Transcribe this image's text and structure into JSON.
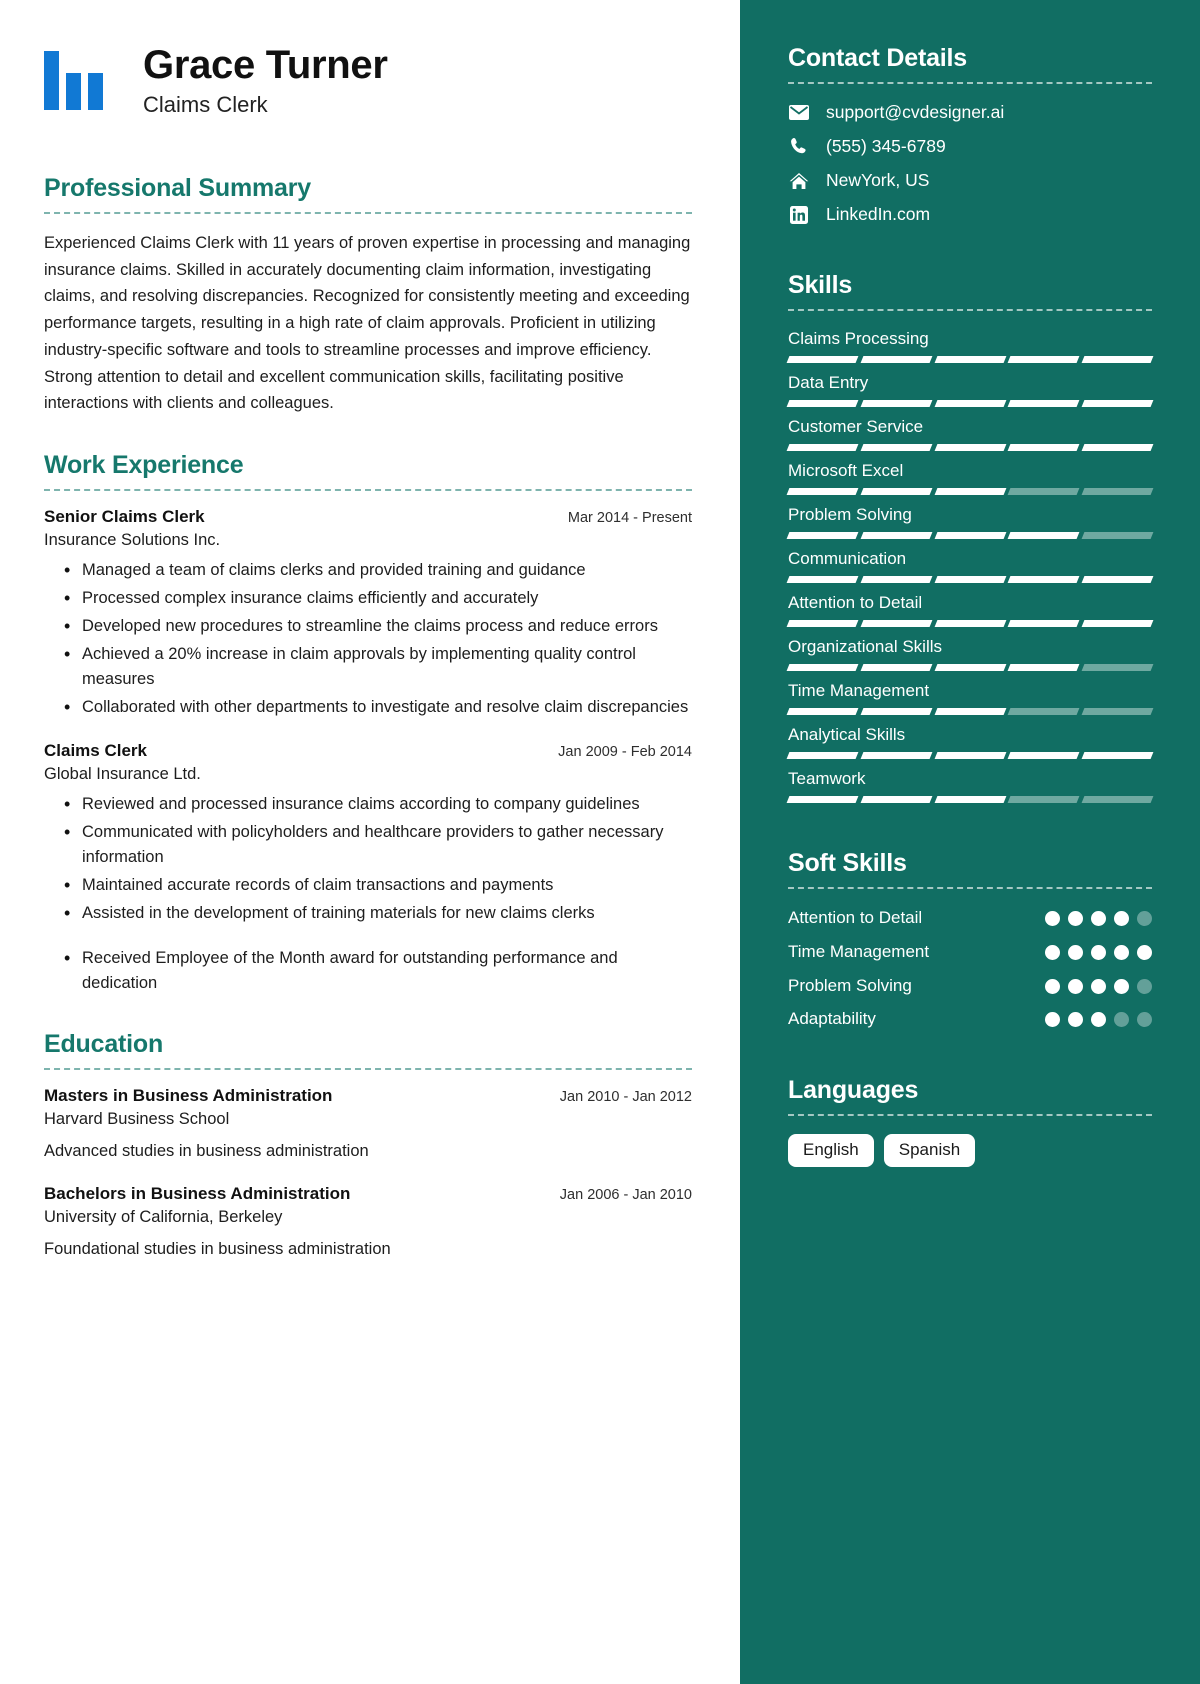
{
  "theme": {
    "sidebar_bg": "#116e63",
    "accent": "#16786c",
    "logo_blue": "#1179d4",
    "sidebar_text": "#ffffff",
    "skill_dim": "#6fa9a1"
  },
  "header": {
    "name": "Grace Turner",
    "job_title": "Claims Clerk"
  },
  "summary": {
    "title": "Professional Summary",
    "text": "Experienced Claims Clerk with 11 years of proven expertise in processing and managing insurance claims. Skilled in accurately documenting claim information, investigating claims, and resolving discrepancies. Recognized for consistently meeting and exceeding performance targets, resulting in a high rate of claim approvals. Proficient in utilizing industry-specific software and tools to streamline processes and improve efficiency. Strong attention to detail and excellent communication skills, facilitating positive interactions with clients and colleagues."
  },
  "work_experience": {
    "title": "Work Experience",
    "entries": [
      {
        "role": "Senior Claims Clerk",
        "date": "Mar 2014 - Present",
        "organization": "Insurance Solutions Inc.",
        "bullets": [
          "Managed a team of claims clerks and provided training and guidance",
          "Processed complex insurance claims efficiently and accurately",
          "Developed new procedures to streamline the claims process and reduce errors",
          "Achieved a 20% increase in claim approvals by implementing quality control measures",
          "Collaborated with other departments to investigate and resolve claim discrepancies"
        ]
      },
      {
        "role": "Claims Clerk",
        "date": "Jan 2009 - Feb 2014",
        "organization": "Global Insurance Ltd.",
        "bullets": [
          "Reviewed and processed insurance claims according to company guidelines",
          "Communicated with policyholders and healthcare providers to gather necessary information",
          "Maintained accurate records of claim transactions and payments",
          "Assisted in the development of training materials for new claims clerks"
        ],
        "extra_bullets": [
          "Received Employee of the Month award for outstanding performance and dedication"
        ]
      }
    ]
  },
  "education": {
    "title": "Education",
    "entries": [
      {
        "degree": "Masters in Business Administration",
        "date": "Jan 2010 - Jan 2012",
        "school": "Harvard Business School",
        "description": "Advanced studies in business administration"
      },
      {
        "degree": "Bachelors in Business Administration",
        "date": "Jan 2006 - Jan 2010",
        "school": "University of California, Berkeley",
        "description": "Foundational studies in business administration"
      }
    ]
  },
  "contact": {
    "title": "Contact Details",
    "items": [
      {
        "icon": "envelope-icon",
        "value": "support@cvdesigner.ai"
      },
      {
        "icon": "phone-icon",
        "value": "(555) 345-6789"
      },
      {
        "icon": "home-icon",
        "value": "NewYork, US"
      },
      {
        "icon": "linkedin-icon",
        "value": "LinkedIn.com"
      }
    ]
  },
  "skills": {
    "title": "Skills",
    "segments_total": 5,
    "items": [
      {
        "name": "Claims Processing",
        "filled": 5
      },
      {
        "name": "Data Entry",
        "filled": 5
      },
      {
        "name": "Customer Service",
        "filled": 5
      },
      {
        "name": "Microsoft Excel",
        "filled": 3
      },
      {
        "name": "Problem Solving",
        "filled": 4
      },
      {
        "name": "Communication",
        "filled": 5
      },
      {
        "name": "Attention to Detail",
        "filled": 5
      },
      {
        "name": "Organizational Skills",
        "filled": 4
      },
      {
        "name": "Time Management",
        "filled": 3
      },
      {
        "name": "Analytical Skills",
        "filled": 5
      },
      {
        "name": "Teamwork",
        "filled": 3
      }
    ]
  },
  "soft_skills": {
    "title": "Soft Skills",
    "dots_total": 5,
    "items": [
      {
        "name": "Attention to Detail",
        "filled": 4
      },
      {
        "name": "Time Management",
        "filled": 5
      },
      {
        "name": "Problem Solving",
        "filled": 4
      },
      {
        "name": "Adaptability",
        "filled": 3
      }
    ]
  },
  "languages": {
    "title": "Languages",
    "items": [
      "English",
      "Spanish"
    ]
  }
}
